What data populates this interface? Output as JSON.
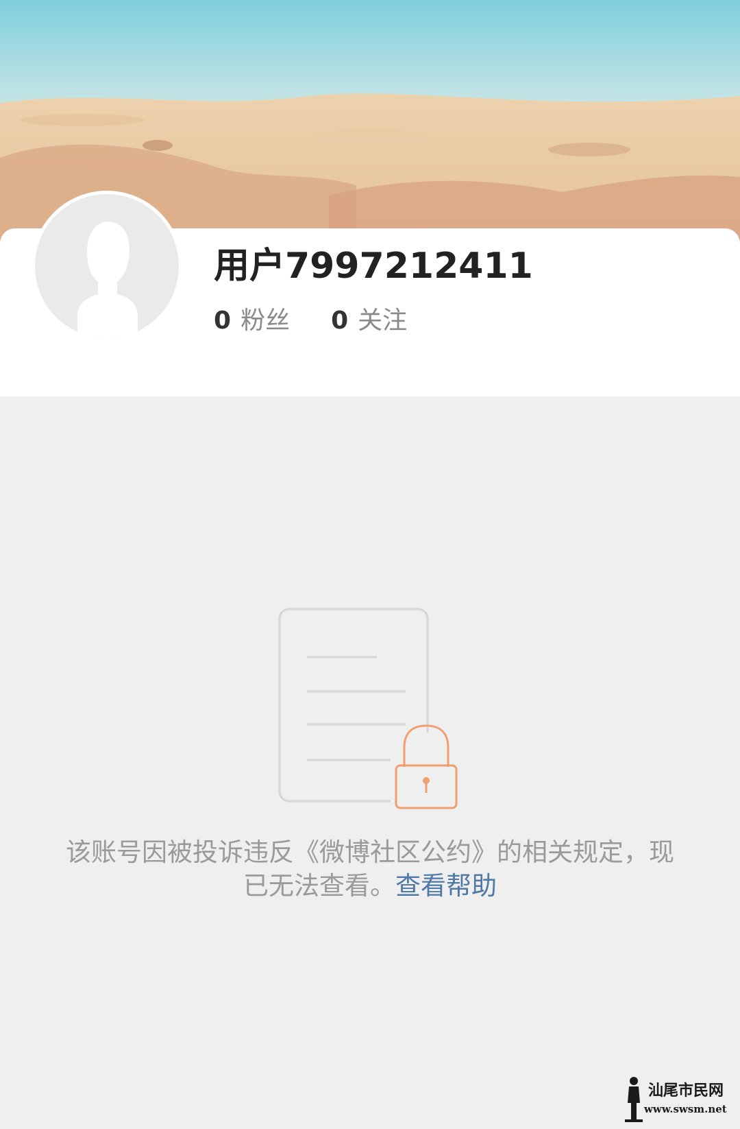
{
  "profile": {
    "username": "用户7997212411",
    "stats": [
      {
        "count": "0",
        "label": "粉丝"
      },
      {
        "count": "0",
        "label": "关注"
      }
    ]
  },
  "blocked": {
    "message": "该账号因被投诉违反《微博社区公约》的相关规定，现已无法查看。",
    "help_link": "查看帮助"
  },
  "watermark": {
    "site_name": "汕尾市民网",
    "url": "www.swsm.net"
  },
  "colors": {
    "background": "#efefef",
    "card": "#ffffff",
    "link": "#4f79a6",
    "lock_accent": "#f0a070",
    "muted_text": "#9a9a9a"
  },
  "icons": {
    "avatar": "default-avatar-silhouette",
    "illustration": "document-lock-icon"
  }
}
